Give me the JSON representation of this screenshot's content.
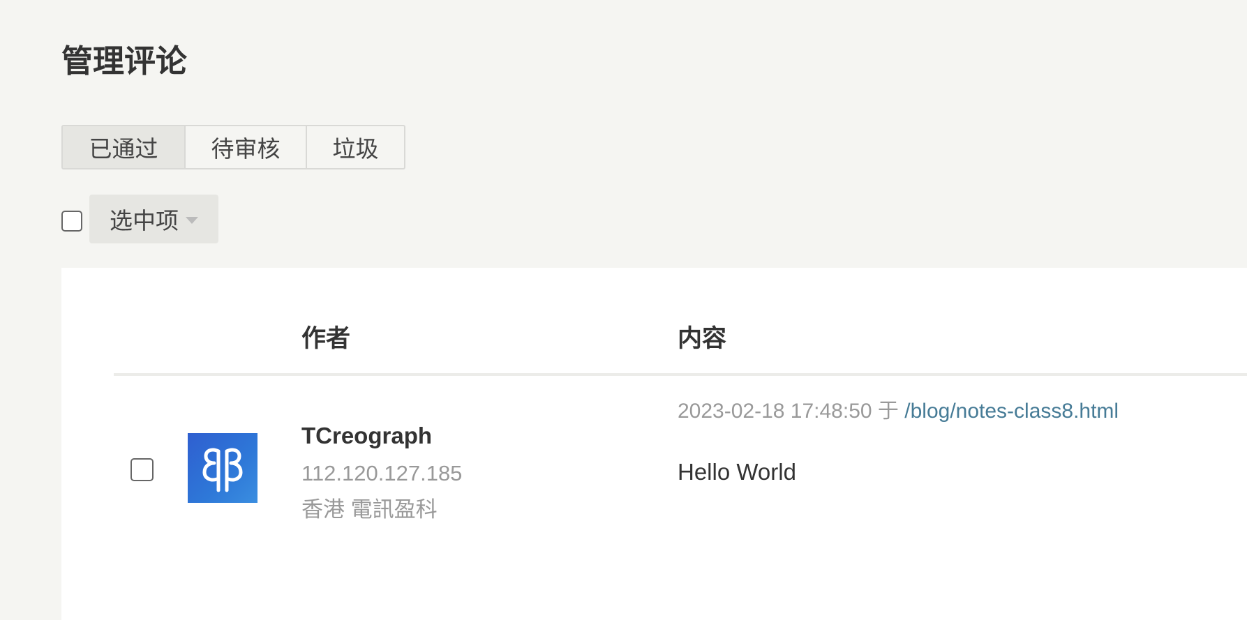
{
  "page": {
    "title": "管理评论"
  },
  "tabs": [
    {
      "label": "已通过",
      "active": true
    },
    {
      "label": "待审核",
      "active": false
    },
    {
      "label": "垃圾",
      "active": false
    }
  ],
  "bulk": {
    "select_label": "选中项",
    "caret_icon": "caret-down-icon"
  },
  "table": {
    "columns": {
      "author": "作者",
      "content": "内容"
    },
    "rows": [
      {
        "author_name": "TCreograph",
        "author_ip": "112.120.127.185",
        "author_location": "香港 電訊盈科",
        "avatar_icon": "identicon-avatar",
        "date": "2023-02-18 17:48:50",
        "at": "于",
        "link": "/blog/notes-class8.html",
        "text": "Hello World"
      }
    ]
  },
  "colors": {
    "background": "#f5f5f2",
    "panel": "#ffffff",
    "link": "#467b96",
    "avatar": "#2f6ad4",
    "muted_text": "#999999"
  }
}
